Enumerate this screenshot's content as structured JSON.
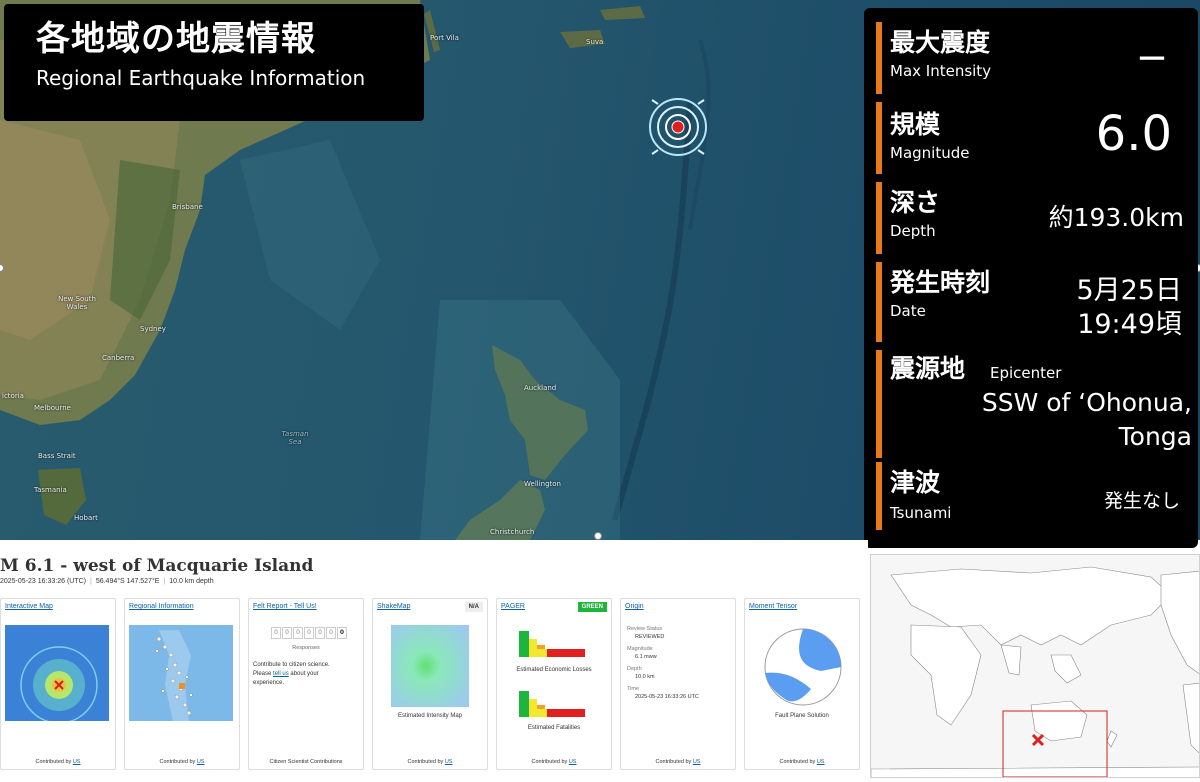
{
  "title": {
    "jp": "各地域の地震情報",
    "en": "Regional Earthquake Information"
  },
  "info": {
    "max_intensity": {
      "jp": "最大震度",
      "en": "Max  Intensity",
      "value": "－"
    },
    "magnitude": {
      "jp": "規模",
      "en": "Magnitude",
      "value": "6.0"
    },
    "depth": {
      "jp": "深さ",
      "en": "Depth",
      "value": "約193.0km"
    },
    "date": {
      "jp": "発生時刻",
      "en": "Date",
      "value_line1": "5月25日",
      "value_line2": "19:49頃"
    },
    "epicenter": {
      "jp": "震源地",
      "en": "Epicenter",
      "value_line1": "SSW of ‘Ohonua,",
      "value_line2": "Tonga"
    },
    "tsunami": {
      "jp": "津波",
      "en": "Tsunami",
      "value": "発生なし"
    }
  },
  "map_labels": {
    "port_vila": "Port Vila",
    "suva": "Suva",
    "brisbane": "Brisbane",
    "new_south_wales": "New South Wales",
    "sydney": "Sydney",
    "canberra": "Canberra",
    "victoria": "ictoria",
    "melbourne": "Melbourne",
    "bass_strait": "Bass Strait",
    "tasmania": "Tasmania",
    "hobart": "Hobart",
    "tasman_sea": "Tasman Sea",
    "auckland": "Auckland",
    "wellington": "Wellington",
    "christchurch": "Christchurch"
  },
  "usgs": {
    "title": "M 6.1 - west of Macquarie Island",
    "datetime": "2025-05-23 16:33:26 (UTC)",
    "location": "56.494°S 147.527°E",
    "depth": "10.0 km depth",
    "cards": {
      "interactive_map": {
        "title": "Interactive Map",
        "foot_prefix": "Contributed by ",
        "foot_link": "US"
      },
      "regional_info": {
        "title": "Regional Information",
        "foot_prefix": "Contributed by ",
        "foot_link": "US"
      },
      "felt_report": {
        "title": "Felt Report - Tell Us!",
        "counter": [
          "0",
          "0",
          "0",
          "0",
          "0",
          "0"
        ],
        "counter_last": "0",
        "responses": "Responses",
        "text_1": "Contribute to citizen science.",
        "text_2_prefix": "Please ",
        "text_2_link": "tell us",
        "text_2_suffix": " about your",
        "text_3": "experience.",
        "foot": "Citizen Scientist Contributions"
      },
      "shakemap": {
        "title": "ShakeMap",
        "badge": "N/A",
        "caption": "Estimated Intensity Map",
        "foot_prefix": "Contributed by ",
        "foot_link": "US"
      },
      "pager": {
        "title": "PAGER",
        "badge": "GREEN",
        "caption_1": "Estimated Economic Losses",
        "caption_2": "Estimated Fatalities",
        "foot_prefix": "Contributed by ",
        "foot_link": "US"
      },
      "origin": {
        "title": "Origin",
        "review_label": "Review Status",
        "review_value": "REVIEWED",
        "magnitude_label": "Magnitude",
        "magnitude_value": "6.1 mww",
        "depth_label": "Depth",
        "depth_value": "10.0 km",
        "time_label": "Time",
        "time_value": "2025-05-23 16:33:26 UTC",
        "foot_prefix": "Contributed by ",
        "foot_link": "US"
      },
      "moment_tensor": {
        "title": "Moment Tensor",
        "caption": "Fault Plane Solution",
        "foot_prefix": "Contributed by ",
        "foot_link": "US"
      }
    }
  },
  "colors": {
    "accent_bar": "#e87a1e",
    "link": "#0b62a8",
    "pager_green": "#1db53b",
    "epicenter_red": "#e02020"
  }
}
